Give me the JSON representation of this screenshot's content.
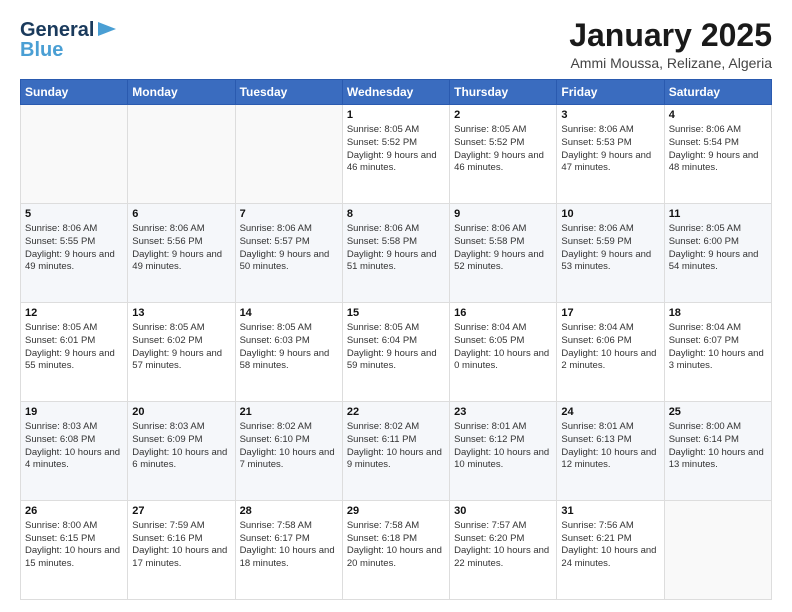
{
  "logo": {
    "line1": "General",
    "line2": "Blue"
  },
  "title": "January 2025",
  "subtitle": "Ammi Moussa, Relizane, Algeria",
  "days_header": [
    "Sunday",
    "Monday",
    "Tuesday",
    "Wednesday",
    "Thursday",
    "Friday",
    "Saturday"
  ],
  "weeks": [
    [
      {
        "day": "",
        "info": ""
      },
      {
        "day": "",
        "info": ""
      },
      {
        "day": "",
        "info": ""
      },
      {
        "day": "1",
        "info": "Sunrise: 8:05 AM\nSunset: 5:52 PM\nDaylight: 9 hours and 46 minutes."
      },
      {
        "day": "2",
        "info": "Sunrise: 8:05 AM\nSunset: 5:52 PM\nDaylight: 9 hours and 46 minutes."
      },
      {
        "day": "3",
        "info": "Sunrise: 8:06 AM\nSunset: 5:53 PM\nDaylight: 9 hours and 47 minutes."
      },
      {
        "day": "4",
        "info": "Sunrise: 8:06 AM\nSunset: 5:54 PM\nDaylight: 9 hours and 48 minutes."
      }
    ],
    [
      {
        "day": "5",
        "info": "Sunrise: 8:06 AM\nSunset: 5:55 PM\nDaylight: 9 hours and 49 minutes."
      },
      {
        "day": "6",
        "info": "Sunrise: 8:06 AM\nSunset: 5:56 PM\nDaylight: 9 hours and 49 minutes."
      },
      {
        "day": "7",
        "info": "Sunrise: 8:06 AM\nSunset: 5:57 PM\nDaylight: 9 hours and 50 minutes."
      },
      {
        "day": "8",
        "info": "Sunrise: 8:06 AM\nSunset: 5:58 PM\nDaylight: 9 hours and 51 minutes."
      },
      {
        "day": "9",
        "info": "Sunrise: 8:06 AM\nSunset: 5:58 PM\nDaylight: 9 hours and 52 minutes."
      },
      {
        "day": "10",
        "info": "Sunrise: 8:06 AM\nSunset: 5:59 PM\nDaylight: 9 hours and 53 minutes."
      },
      {
        "day": "11",
        "info": "Sunrise: 8:05 AM\nSunset: 6:00 PM\nDaylight: 9 hours and 54 minutes."
      }
    ],
    [
      {
        "day": "12",
        "info": "Sunrise: 8:05 AM\nSunset: 6:01 PM\nDaylight: 9 hours and 55 minutes."
      },
      {
        "day": "13",
        "info": "Sunrise: 8:05 AM\nSunset: 6:02 PM\nDaylight: 9 hours and 57 minutes."
      },
      {
        "day": "14",
        "info": "Sunrise: 8:05 AM\nSunset: 6:03 PM\nDaylight: 9 hours and 58 minutes."
      },
      {
        "day": "15",
        "info": "Sunrise: 8:05 AM\nSunset: 6:04 PM\nDaylight: 9 hours and 59 minutes."
      },
      {
        "day": "16",
        "info": "Sunrise: 8:04 AM\nSunset: 6:05 PM\nDaylight: 10 hours and 0 minutes."
      },
      {
        "day": "17",
        "info": "Sunrise: 8:04 AM\nSunset: 6:06 PM\nDaylight: 10 hours and 2 minutes."
      },
      {
        "day": "18",
        "info": "Sunrise: 8:04 AM\nSunset: 6:07 PM\nDaylight: 10 hours and 3 minutes."
      }
    ],
    [
      {
        "day": "19",
        "info": "Sunrise: 8:03 AM\nSunset: 6:08 PM\nDaylight: 10 hours and 4 minutes."
      },
      {
        "day": "20",
        "info": "Sunrise: 8:03 AM\nSunset: 6:09 PM\nDaylight: 10 hours and 6 minutes."
      },
      {
        "day": "21",
        "info": "Sunrise: 8:02 AM\nSunset: 6:10 PM\nDaylight: 10 hours and 7 minutes."
      },
      {
        "day": "22",
        "info": "Sunrise: 8:02 AM\nSunset: 6:11 PM\nDaylight: 10 hours and 9 minutes."
      },
      {
        "day": "23",
        "info": "Sunrise: 8:01 AM\nSunset: 6:12 PM\nDaylight: 10 hours and 10 minutes."
      },
      {
        "day": "24",
        "info": "Sunrise: 8:01 AM\nSunset: 6:13 PM\nDaylight: 10 hours and 12 minutes."
      },
      {
        "day": "25",
        "info": "Sunrise: 8:00 AM\nSunset: 6:14 PM\nDaylight: 10 hours and 13 minutes."
      }
    ],
    [
      {
        "day": "26",
        "info": "Sunrise: 8:00 AM\nSunset: 6:15 PM\nDaylight: 10 hours and 15 minutes."
      },
      {
        "day": "27",
        "info": "Sunrise: 7:59 AM\nSunset: 6:16 PM\nDaylight: 10 hours and 17 minutes."
      },
      {
        "day": "28",
        "info": "Sunrise: 7:58 AM\nSunset: 6:17 PM\nDaylight: 10 hours and 18 minutes."
      },
      {
        "day": "29",
        "info": "Sunrise: 7:58 AM\nSunset: 6:18 PM\nDaylight: 10 hours and 20 minutes."
      },
      {
        "day": "30",
        "info": "Sunrise: 7:57 AM\nSunset: 6:20 PM\nDaylight: 10 hours and 22 minutes."
      },
      {
        "day": "31",
        "info": "Sunrise: 7:56 AM\nSunset: 6:21 PM\nDaylight: 10 hours and 24 minutes."
      },
      {
        "day": "",
        "info": ""
      }
    ]
  ]
}
